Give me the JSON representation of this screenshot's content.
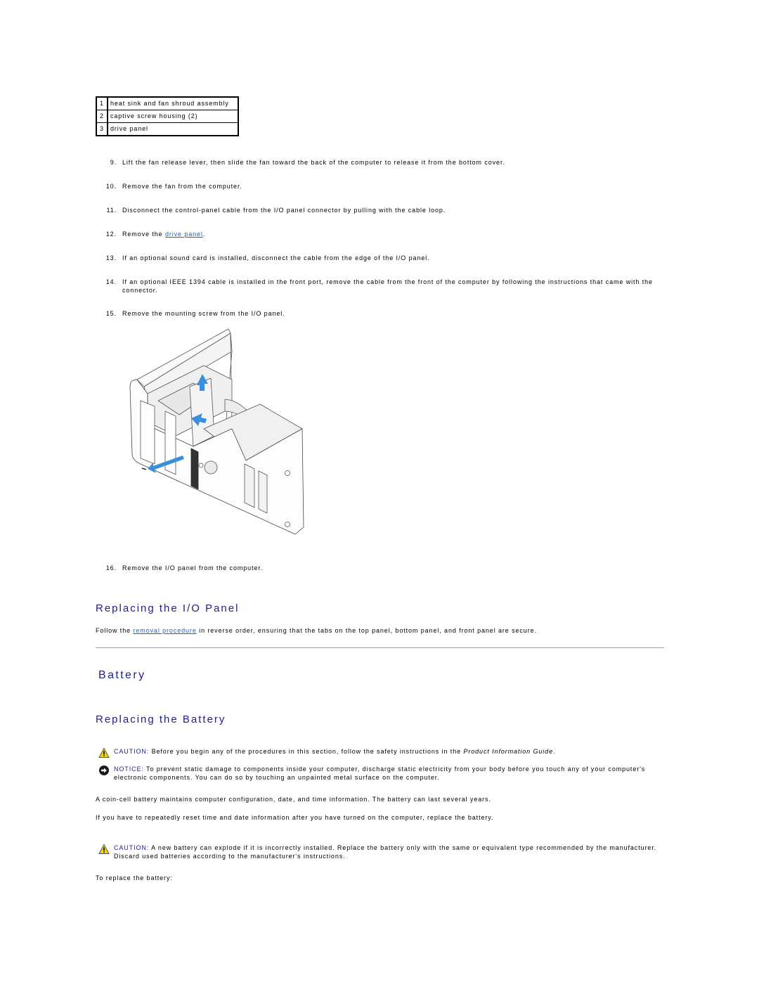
{
  "legend": [
    {
      "num": "1",
      "label": "heat sink and fan shroud assembly"
    },
    {
      "num": "2",
      "label": "captive screw housing (2)"
    },
    {
      "num": "3",
      "label": "drive panel"
    }
  ],
  "steps": [
    {
      "num": "9.",
      "text": "Lift the fan release lever, then slide the fan toward the back of the computer to release it from the bottom cover."
    },
    {
      "num": "10.",
      "text": "Remove the fan from the computer."
    },
    {
      "num": "11.",
      "text": "Disconnect the control-panel cable from the I/O panel connector by pulling with the cable loop."
    },
    {
      "num": "12.",
      "pre": "Remove the ",
      "link": "drive panel",
      "post": "."
    },
    {
      "num": "13.",
      "text": "If an optional sound card is installed, disconnect the cable from the edge of the I/O panel."
    },
    {
      "num": "14.",
      "text": "If an optional IEEE 1394 cable is installed in the front port, remove the cable from the front of the computer by following the instructions that came with the connector."
    },
    {
      "num": "15.",
      "text": "Remove the mounting screw from the I/O panel."
    },
    {
      "num": "16.",
      "text": "Remove the I/O panel from the computer."
    }
  ],
  "figure": {
    "icon": "io-panel-removal-illustration",
    "arrow_color": "#3a8fdc"
  },
  "replacing_io": {
    "heading": "Replacing the I/O Panel",
    "pre": "Follow the ",
    "link": "removal procedure",
    "post": " in reverse order, ensuring that the tabs on the top panel, bottom panel, and front panel are secure."
  },
  "battery": {
    "heading": "Battery",
    "subheading": "Replacing the Battery",
    "caution1": {
      "icon": "warning-triangle-icon",
      "label": "CAUTION:",
      "pre": " Before you begin any of the procedures in this section, follow the safety instructions in the ",
      "em": "Product Information Guide",
      "post": "."
    },
    "notice": {
      "icon": "notice-arrow-icon",
      "label": "NOTICE:",
      "text": " To prevent static damage to components inside your computer, discharge static electricity from your body before you touch any of your computer's electronic components. You can do so by touching an unpainted metal surface on the computer."
    },
    "para1": "A coin-cell battery maintains computer configuration, date, and time information. The battery can last several years.",
    "para2": "If you have to repeatedly reset time and date information after you have turned on the computer, replace the battery.",
    "caution2": {
      "icon": "warning-triangle-icon",
      "label": "CAUTION:",
      "text": " A new battery can explode if it is incorrectly installed. Replace the battery only with the same or equivalent type recommended by the manufacturer. Discard used batteries according to the manufacturer's instructions."
    },
    "para3": "To replace the battery:"
  },
  "colors": {
    "heading": "#1e1e8c",
    "link": "#1a5fc8",
    "rule": "#a0a0a0",
    "caution_yellow": "#f2d600"
  }
}
